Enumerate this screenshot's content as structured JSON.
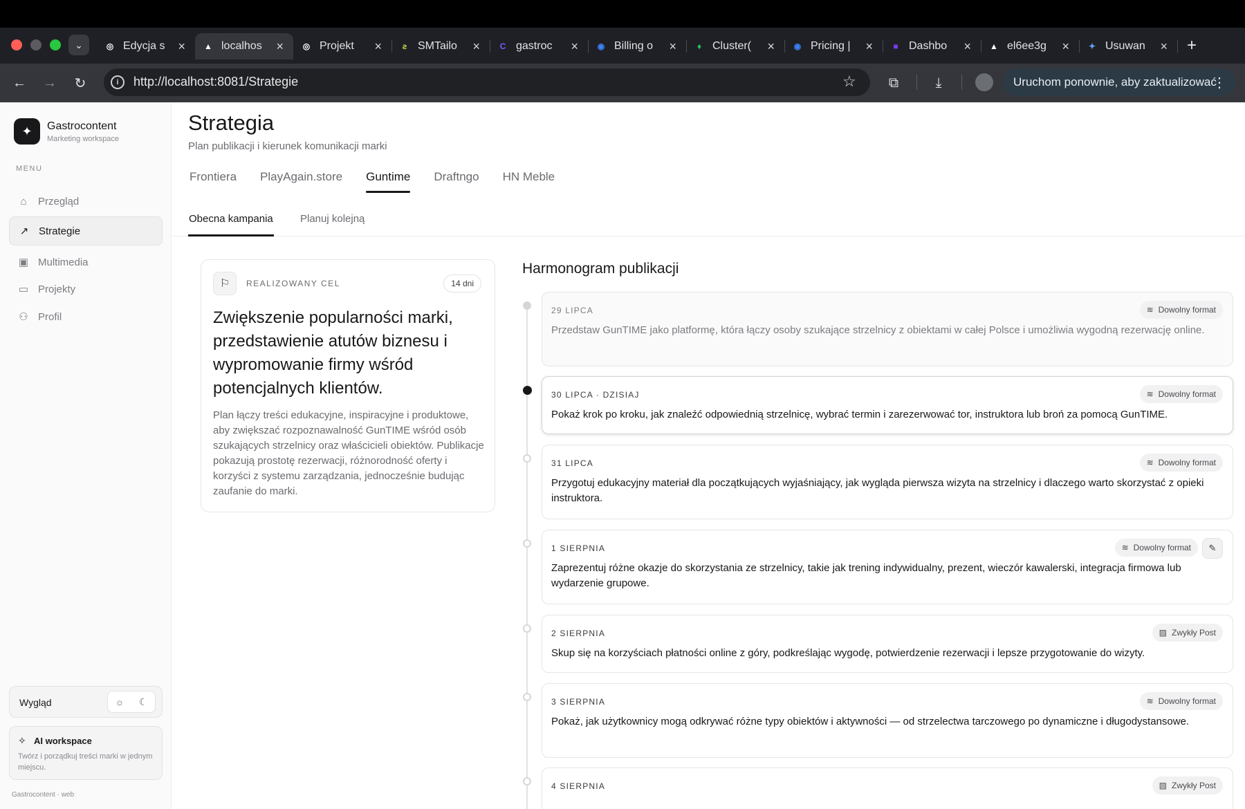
{
  "browser": {
    "tabs": [
      {
        "title": "Edycja s",
        "favicon_color": "#ffffff",
        "favicon_glyph": "◎"
      },
      {
        "title": "localhos",
        "favicon_color": "#ffffff",
        "favicon_glyph": "▲",
        "active": true
      },
      {
        "title": "Projekt",
        "favicon_color": "#ffffff",
        "favicon_glyph": "◎"
      },
      {
        "title": "SMTailo",
        "favicon_color": "#c8e04a",
        "favicon_glyph": "ƨ"
      },
      {
        "title": "gastroc",
        "favicon_color": "#7b5cff",
        "favicon_glyph": "C"
      },
      {
        "title": "Billing o",
        "favicon_color": "#3b82f6",
        "favicon_glyph": "◉"
      },
      {
        "title": "Cluster(",
        "favicon_color": "#22c55e",
        "favicon_glyph": "♦"
      },
      {
        "title": "Pricing |",
        "favicon_color": "#3b82f6",
        "favicon_glyph": "◉"
      },
      {
        "title": "Dashbo",
        "favicon_color": "#7c3aed",
        "favicon_glyph": "■"
      },
      {
        "title": "el6ee3g",
        "favicon_color": "#ffffff",
        "favicon_glyph": "▲"
      },
      {
        "title": "Usuwan",
        "favicon_color": "#60a5fa",
        "favicon_glyph": "✦"
      }
    ],
    "url": "http://localhost:8081/Strategie",
    "update_label": "Uruchom ponownie, aby zaktualizować"
  },
  "sidebar": {
    "brand_name": "Gastrocontent",
    "brand_sub": "Marketing workspace",
    "menu_label": "MENU",
    "items": [
      {
        "label": "Przegląd",
        "icon": "home-icon"
      },
      {
        "label": "Strategie",
        "icon": "trending-up-icon",
        "active": true
      },
      {
        "label": "Multimedia",
        "icon": "image-stack-icon"
      },
      {
        "label": "Projekty",
        "icon": "folder-icon"
      },
      {
        "label": "Profil",
        "icon": "user-icon"
      }
    ],
    "appearance_label": "Wygląd",
    "ai_title": "AI workspace",
    "ai_text": "Twórz i porządkuj treści marki w jednym miejscu.",
    "footer": "Gastrocontent · web"
  },
  "page": {
    "title": "Strategia",
    "subtitle": "Plan publikacji i kierunek komunikacji marki",
    "brand_tabs": [
      {
        "label": "Frontiera"
      },
      {
        "label": "PlayAgain.store"
      },
      {
        "label": "Guntime",
        "active": true
      },
      {
        "label": "Draftngo"
      },
      {
        "label": "HN Meble"
      }
    ],
    "sub_tabs": {
      "current": "Obecna kampania",
      "next": "Planuj kolejną"
    }
  },
  "goal": {
    "label": "REALIZOWANY CEL",
    "days": "14 dni",
    "title": "Zwiększenie popularności marki, przedstawienie atutów biznesu i wypromowanie firmy wśród potencjalnych klientów.",
    "description": "Plan łączy treści edukacyjne, inspiracyjne i produktowe, aby zwiększać rozpoznawalność GunTIME wśród osób szukających strzelnicy oraz właścicieli obiektów. Publikacje pokazują prostotę rezerwacji, różnorodność oferty i korzyści z systemu zarządzania, jednocześnie budując zaufanie do marki."
  },
  "schedule": {
    "title": "Harmonogram publikacji",
    "entries": [
      {
        "date": "29 LIPCA",
        "format": "Dowolny format",
        "format_icon": "layers-icon",
        "status": "past",
        "text": "Przedstaw GunTIME jako platformę, która łączy osoby szukające strzelnicy z obiektami w całej Polsce i umożliwia wygodną rezerwację online."
      },
      {
        "date": "30 LIPCA · DZISIAJ",
        "format": "Dowolny format",
        "format_icon": "layers-icon",
        "status": "today",
        "text": "Pokaż krok po kroku, jak znaleźć odpowiednią strzelnicę, wybrać termin i zarezerwować tor, instruktora lub broń za pomocą GunTIME."
      },
      {
        "date": "31 LIPCA",
        "format": "Dowolny format",
        "format_icon": "layers-icon",
        "status": "upcoming",
        "text": "Przygotuj edukacyjny materiał dla początkujących wyjaśniający, jak wygląda pierwsza wizyta na strzelnicy i dlaczego warto skorzystać z opieki instruktora."
      },
      {
        "date": "1 SIERPNIA",
        "format": "Dowolny format",
        "format_icon": "layers-icon",
        "status": "upcoming",
        "editable": true,
        "text": "Zaprezentuj różne okazje do skorzystania ze strzelnicy, takie jak trening indywidualny, prezent, wieczór kawalerski, integracja firmowa lub wydarzenie grupowe."
      },
      {
        "date": "2 SIERPNIA",
        "format": "Zwykły Post",
        "format_icon": "image-icon",
        "status": "upcoming",
        "text": "Skup się na korzyściach płatności online z góry, podkreślając wygodę, potwierdzenie rezerwacji i lepsze przygotowanie do wizyty."
      },
      {
        "date": "3 SIERPNIA",
        "format": "Dowolny format",
        "format_icon": "layers-icon",
        "status": "upcoming",
        "text": "Pokaż, jak użytkownicy mogą odkrywać różne typy obiektów i aktywności — od strzelectwa tarczowego po dynamiczne i długodystansowe."
      },
      {
        "date": "4 SIERPNIA",
        "format": "Zwykły Post",
        "format_icon": "image-icon",
        "status": "upcoming",
        "text": ""
      }
    ]
  }
}
